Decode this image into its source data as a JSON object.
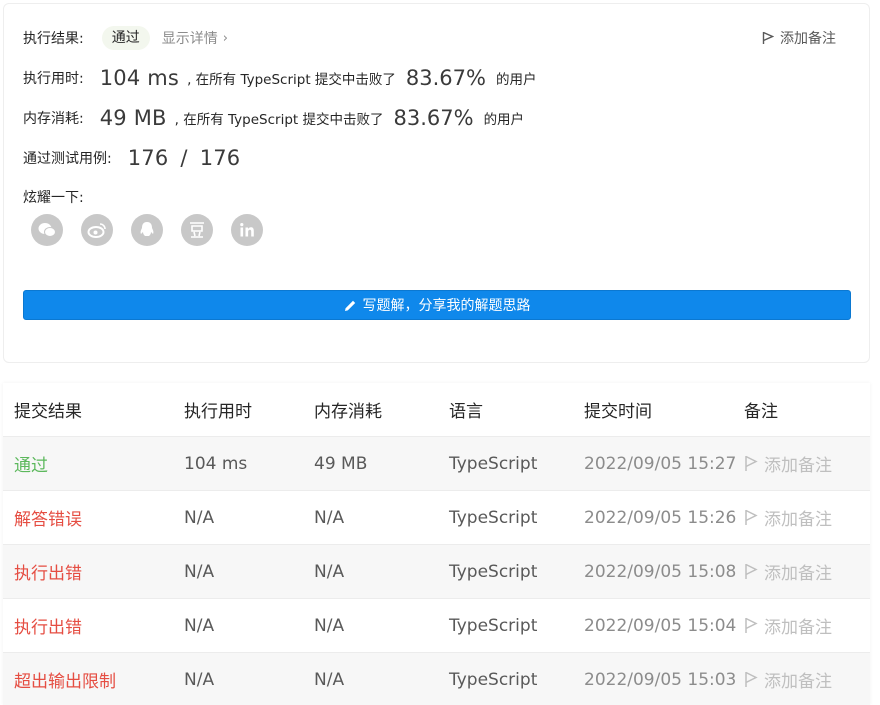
{
  "summary": {
    "result_label": "执行结果:",
    "result_status": "通过",
    "show_details": "显示详情",
    "add_note": "添加备注",
    "runtime": {
      "label": "执行用时:",
      "value": "104 ms",
      "prefix": ", 在所有 TypeScript 提交中击败了",
      "percent": "83.67%",
      "suffix": "的用户"
    },
    "memory": {
      "label": "内存消耗:",
      "value": "49 MB",
      "prefix": ", 在所有 TypeScript 提交中击败了",
      "percent": "83.67%",
      "suffix": "的用户"
    },
    "tests": {
      "label": "通过测试用例:",
      "passed": "176",
      "separator": "/",
      "total": "176"
    },
    "share_label": "炫耀一下:",
    "share_icons": [
      "wechat-icon",
      "weibo-icon",
      "qq-icon",
      "douban-icon",
      "linkedin-icon"
    ],
    "write_solution": "写题解，分享我的解题思路"
  },
  "table": {
    "headers": [
      "提交结果",
      "执行用时",
      "内存消耗",
      "语言",
      "提交时间",
      "备注"
    ],
    "rows": [
      {
        "result": "通过",
        "runtime": "104 ms",
        "memory": "49 MB",
        "language": "TypeScript",
        "time": "2022/09/05 15:27",
        "note": "添加备注"
      },
      {
        "result": "解答错误",
        "runtime": "N/A",
        "memory": "N/A",
        "language": "TypeScript",
        "time": "2022/09/05 15:26",
        "note": "添加备注"
      },
      {
        "result": "执行出错",
        "runtime": "N/A",
        "memory": "N/A",
        "language": "TypeScript",
        "time": "2022/09/05 15:08",
        "note": "添加备注"
      },
      {
        "result": "执行出错",
        "runtime": "N/A",
        "memory": "N/A",
        "language": "TypeScript",
        "time": "2022/09/05 15:04",
        "note": "添加备注"
      },
      {
        "result": "超出输出限制",
        "runtime": "N/A",
        "memory": "N/A",
        "language": "TypeScript",
        "time": "2022/09/05 15:03",
        "note": "添加备注"
      }
    ]
  },
  "colors": {
    "accepted": "#5cb85c",
    "error": "#e54d42",
    "primary_button": "#0f88eb"
  }
}
